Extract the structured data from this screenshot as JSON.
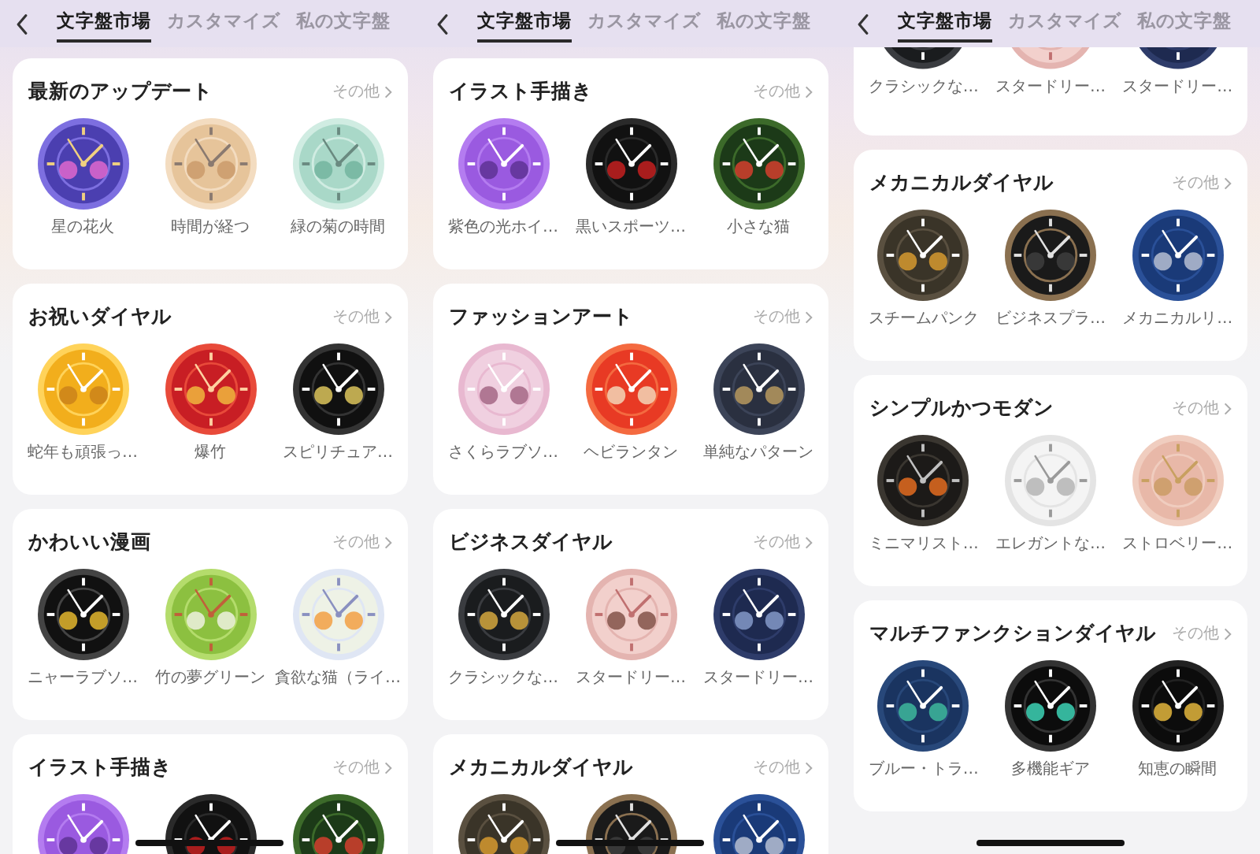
{
  "screens": [
    {
      "tabs": [
        {
          "label": "文字盤市場",
          "selected": true
        },
        {
          "label": "カスタマイズ",
          "selected": false
        },
        {
          "label": "私の文字盤",
          "selected": false
        }
      ],
      "sections": [
        {
          "title": "最新のアップデート",
          "more": "その他",
          "cut_top": false,
          "faces": [
            {
              "name": "星の花火"
            },
            {
              "name": "時間が経つ"
            },
            {
              "name": "緑の菊の時間"
            }
          ]
        },
        {
          "title": "お祝いダイヤル",
          "more": "その他",
          "cut_top": false,
          "faces": [
            {
              "name": "蛇年も頑張っ…"
            },
            {
              "name": "爆竹"
            },
            {
              "name": "スピリチュア…"
            }
          ]
        },
        {
          "title": "かわいい漫画",
          "more": "その他",
          "cut_top": false,
          "faces": [
            {
              "name": "ニャーラブソ…"
            },
            {
              "name": "竹の夢グリーン"
            },
            {
              "name": "貪欲な猫（ライ…"
            }
          ]
        },
        {
          "title": "イラスト手描き",
          "more": "その他",
          "cut_top": false
        }
      ]
    },
    {
      "tabs": [
        {
          "label": "文字盤市場",
          "selected": true
        },
        {
          "label": "カスタマイズ",
          "selected": false
        },
        {
          "label": "私の文字盤",
          "selected": false
        }
      ],
      "sections": [
        {
          "title": "イラスト手描き",
          "more": "その他",
          "cut_top": false,
          "faces": [
            {
              "name": "紫色の光ホイ…"
            },
            {
              "name": "黒いスポーツ…"
            },
            {
              "name": "小さな猫"
            }
          ]
        },
        {
          "title": "ファッションアート",
          "more": "その他",
          "cut_top": false,
          "faces": [
            {
              "name": "さくらラブソ…"
            },
            {
              "name": "ヘビランタン"
            },
            {
              "name": "単純なパターン"
            }
          ]
        },
        {
          "title": "ビジネスダイヤル",
          "more": "その他",
          "cut_top": false,
          "faces": [
            {
              "name": "クラシックな…"
            },
            {
              "name": "スタードリー…"
            },
            {
              "name": "スタードリー…"
            }
          ]
        },
        {
          "title": "メカニカルダイヤル",
          "more": "その他",
          "cut_top": false
        }
      ]
    },
    {
      "tabs": [
        {
          "label": "文字盤市場",
          "selected": true
        },
        {
          "label": "カスタマイズ",
          "selected": false
        },
        {
          "label": "私の文字盤",
          "selected": false
        }
      ],
      "sections": [
        {
          "cut_top": true,
          "faces": [
            {
              "name": "クラシックな…"
            },
            {
              "name": "スタードリー…"
            },
            {
              "name": "スタードリー…"
            }
          ]
        },
        {
          "title": "メカニカルダイヤル",
          "more": "その他",
          "cut_top": false,
          "faces": [
            {
              "name": "スチームパンク"
            },
            {
              "name": "ビジネスプラ…"
            },
            {
              "name": "メカニカルリ…"
            }
          ]
        },
        {
          "title": "シンプルかつモダン",
          "more": "その他",
          "cut_top": false,
          "faces": [
            {
              "name": "ミニマリスト…"
            },
            {
              "name": "エレガントな…"
            },
            {
              "name": "ストロベリー…"
            }
          ]
        },
        {
          "title": "マルチファンクションダイヤル",
          "more": "その他",
          "cut_top": false,
          "faces": [
            {
              "name": "ブルー・トラ…"
            },
            {
              "name": "多機能ギア"
            },
            {
              "name": "知恵の瞬間"
            }
          ]
        }
      ]
    }
  ]
}
